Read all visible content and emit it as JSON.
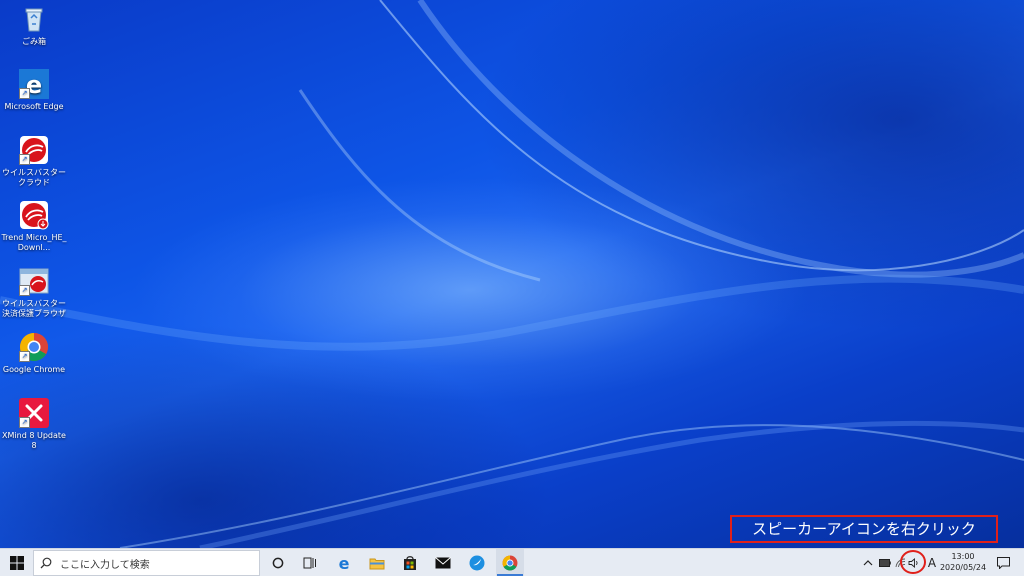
{
  "desktop": {
    "icons": [
      {
        "label": "ごみ箱",
        "icon": "recycle-bin-icon"
      },
      {
        "label": "Microsoft Edge",
        "icon": "edge-icon"
      },
      {
        "label": "ウイルスバスター クラウド",
        "icon": "virusbuster-icon"
      },
      {
        "label": "Trend Micro_HE_Downl...",
        "icon": "trend-micro-installer-icon"
      },
      {
        "label": "ウイルスバスター決済保護ブラウザ",
        "icon": "secure-browser-icon"
      },
      {
        "label": "Google Chrome",
        "icon": "chrome-icon"
      },
      {
        "label": "XMind 8 Update 8",
        "icon": "xmind-icon"
      }
    ]
  },
  "annotation": {
    "text": "スピーカーアイコンを右クリック",
    "color": "#e0201a"
  },
  "taskbar": {
    "search_placeholder": "ここに入力して検索",
    "pinned": [
      "cortana-icon",
      "task-view-icon",
      "edge-icon",
      "file-explorer-icon",
      "store-icon",
      "mail-icon",
      "bird-app-icon",
      "chrome-icon"
    ],
    "tray": {
      "ime": "A",
      "time": "13:00",
      "date": "2020/05/24"
    }
  },
  "colors": {
    "taskbar_bg": "#e6ebf3",
    "desktop_blue": "#0e55e6",
    "highlight": "#e0201a"
  }
}
